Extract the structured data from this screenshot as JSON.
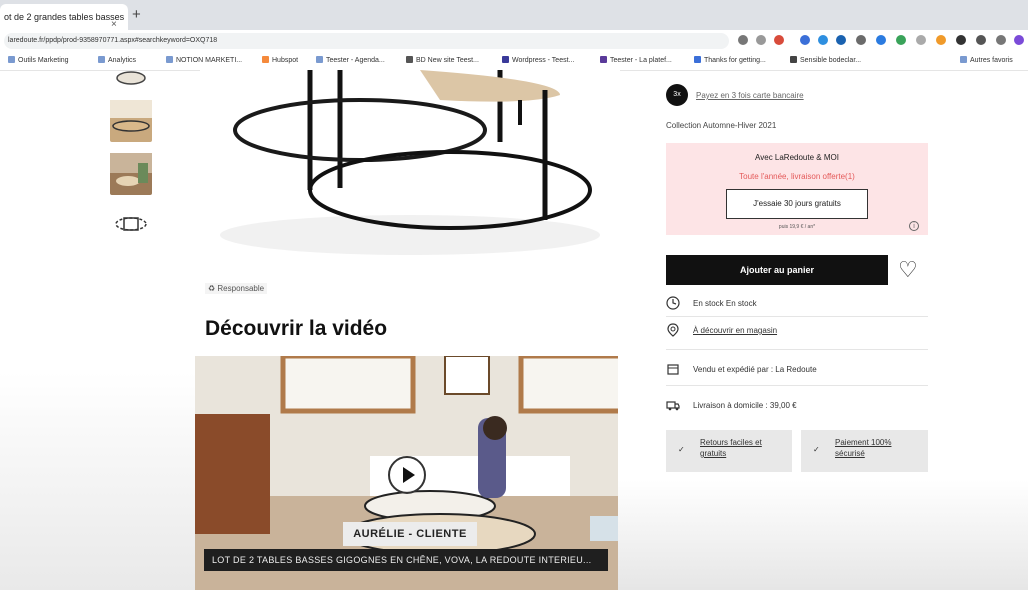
{
  "browser": {
    "tab_title": "ot de 2 grandes tables basses",
    "tab_close": "×",
    "new_tab": "+",
    "url": "laredoute.fr/ppdp/prod-9358970771.aspx#searchkeyword=OXQ718",
    "bookmarks": [
      "Outils Marketing",
      "Analytics",
      "NOTION MARKETI...",
      "Hubspot",
      "Teester - Agenda...",
      "BD New site Teest...",
      "Wordpress - Teest...",
      "Teester - La platef...",
      "Thanks for getting...",
      "Sensible bodeclar...",
      "Autres favoris"
    ]
  },
  "page": {
    "responsable_label": "Responsable",
    "video_section_title": "Découvrir la vidéo",
    "video_caption": "AURÉLIE - CLIENTE",
    "video_bottom_caption": "LOT DE 2 TABLES BASSES GIGOGNES EN CHÊNE, VOVA, LA REDOUTE INTERIEU..."
  },
  "sidebar": {
    "pay_link": "Payez en 3 fois carte bancaire",
    "collection": "Collection Automne-Hiver 2021",
    "promo": {
      "title": "Avec LaRedoute & MOI",
      "subtitle": "Toute l'année, livraison offerte(1)",
      "trial_button": "J'essaie 30 jours gratuits",
      "note": "puis 19,9 € / an*",
      "info": "i"
    },
    "add_to_cart": "Ajouter au panier",
    "stock": "En stock En stock",
    "store": "À découvrir en magasin",
    "sold_by": "Vendu et expédié par : La Redoute",
    "delivery": "Livraison à domicile : 39,00 €",
    "returns": [
      "Retours faciles et",
      "gratuits"
    ],
    "payment": [
      "Paiement 100%",
      "sécurisé"
    ],
    "check": "✓"
  },
  "colors": {
    "promo_bg": "#fde4e6",
    "promo_accent": "#e45a5a",
    "cart_bg": "#111111"
  }
}
